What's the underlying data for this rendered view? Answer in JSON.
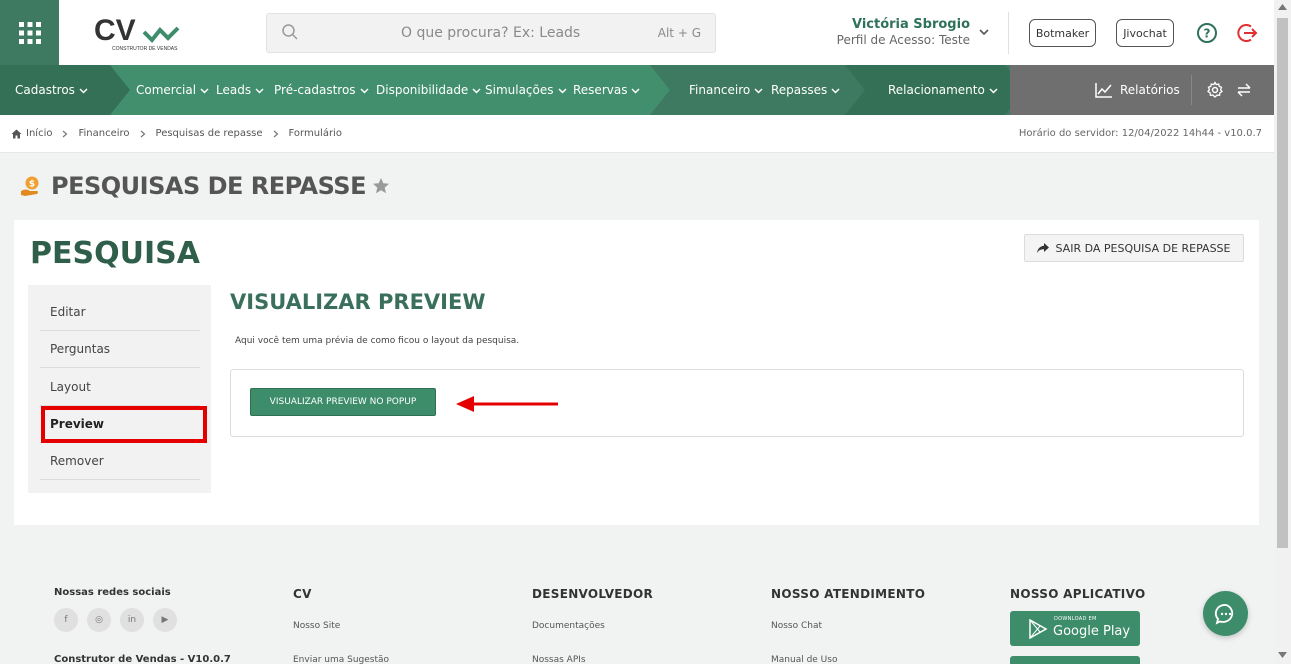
{
  "header": {
    "search_placeholder": "O que procura? Ex: Leads",
    "search_shortcut": "Alt + G",
    "user_name": "Victória Sbrogio",
    "user_profile": "Perfil de Acesso: Teste",
    "botmaker": "Botmaker",
    "jivochat": "Jivochat",
    "logo_text": "CV",
    "logo_sub": "CONSTRUTOR DE VENDAS"
  },
  "nav": {
    "items": [
      "Cadastros",
      "Comercial",
      "Leads",
      "Pré-cadastros",
      "Disponibilidade",
      "Simulações",
      "Reservas",
      "Financeiro",
      "Repasses",
      "Relacionamento"
    ],
    "reports": "Relatórios"
  },
  "breadcrumb": {
    "items": [
      "Início",
      "Financeiro",
      "Pesquisas de repasse",
      "Formulário"
    ],
    "server_time": "Horário do servidor: 12/04/2022 14h44 - v10.0.7"
  },
  "page": {
    "title": "PESQUISAS DE REPASSE",
    "card_title": "PESQUISA",
    "exit_button": "SAIR DA PESQUISA DE REPASSE",
    "side_menu": [
      "Editar",
      "Perguntas",
      "Layout",
      "Preview",
      "Remover"
    ],
    "active_item": "Preview",
    "section_title": "VISUALIZAR PREVIEW",
    "section_desc": "Aqui você tem uma prévia de como ficou o layout da pesquisa.",
    "preview_button": "VISUALIZAR PREVIEW NO POPUP"
  },
  "footer": {
    "social_title": "Nossas redes sociais",
    "version": "Construtor de Vendas - V10.0.7",
    "cv_title": "CV",
    "cv_links": [
      "Nosso Site",
      "Enviar uma Sugestão"
    ],
    "dev_title": "DESENVOLVEDOR",
    "dev_links": [
      "Documentações",
      "Nossas APIs"
    ],
    "support_title": "NOSSO ATENDIMENTO",
    "support_links": [
      "Nosso Chat",
      "Manual de Uso"
    ],
    "app_title": "NOSSO APLICATIVO",
    "google_play_small": "DOWNLOAD EM",
    "google_play": "Google Play"
  },
  "colors": {
    "brand_green": "#3e7a61",
    "button_green": "#3d8d6b",
    "title_green": "#2f5f4b",
    "highlight_red": "#e50000",
    "nav_gray": "#6f6f6f"
  }
}
